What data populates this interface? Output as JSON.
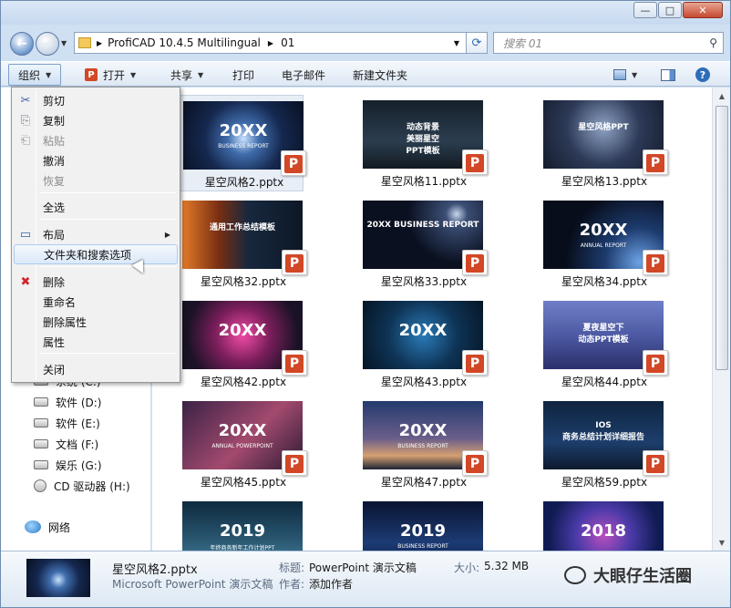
{
  "window": {
    "minimize": "—",
    "maximize": "□",
    "close": "✕"
  },
  "address": {
    "path": [
      "ProfiCAD 10.4.5 Multilingual",
      "01"
    ],
    "search_placeholder": "搜索 01"
  },
  "toolbar": {
    "organize": "组织",
    "open": "打开",
    "share": "共享",
    "print": "打印",
    "email": "电子邮件",
    "new_folder": "新建文件夹"
  },
  "context_menu": {
    "items": [
      "剪切",
      "复制",
      "粘贴",
      "撤消",
      "恢复",
      "全选",
      "布局",
      "文件夹和搜索选项",
      "删除",
      "重命名",
      "删除属性",
      "属性",
      "关闭"
    ],
    "disabled": [
      "粘贴",
      "恢复"
    ],
    "highlighted": "文件夹和搜索选项"
  },
  "nav": {
    "items": [
      "系统 (C:)",
      "软件 (D:)",
      "软件 (E:)",
      "文档 (F:)",
      "娱乐 (G:)",
      "CD 驱动器 (H:)",
      "网络"
    ]
  },
  "files": [
    {
      "name": "星空风格2.pptx",
      "thumb_text": "20XX",
      "thumb_sub": "BUSINESS REPORT",
      "bg": "radial-gradient(circle at 50% 55%,#c8e2ff 0%,#3f6cab 22%,#15284f 55%,#081021 100%)"
    },
    {
      "name": "星空风格11.pptx",
      "thumb_text": "动态背景\n美丽星空\nPPT模板",
      "thumb_sub": "",
      "bg": "linear-gradient(#15202b,#2b3d4f 60%,#121a22)"
    },
    {
      "name": "星空风格13.pptx",
      "thumb_text": "星空风格PPT",
      "thumb_sub": "",
      "bg": "radial-gradient(circle at 50% 40%,#8fa3c4,#2d3a58 50%,#141b2b)"
    },
    {
      "name": "星空风格32.pptx",
      "thumb_text": "通用工作总结模板",
      "thumb_sub": "",
      "bg": "linear-gradient(90deg,#e37b29,#7a2e12 30%,#17283e 55%,#0d1726)"
    },
    {
      "name": "星空风格33.pptx",
      "thumb_text": "20XX BUSINESS REPORT",
      "thumb_sub": "",
      "bg": "radial-gradient(circle at 78% 20%,#c7d6ef,#3b4e74 10%,#0a1020 45%)"
    },
    {
      "name": "星空风格34.pptx",
      "thumb_text": "20XX",
      "thumb_sub": "ANNUAL REPORT",
      "bg": "radial-gradient(circle at 80% 90%,#6da3e6,#1d3b6e 30%,#070d1a 65%)"
    },
    {
      "name": "星空风格42.pptx",
      "thumb_text": "20XX",
      "thumb_sub": "",
      "bg": "radial-gradient(circle at 50% 50%,#f04ca6,#7a1e5a 40%,#1a1226 80%)"
    },
    {
      "name": "星空风格43.pptx",
      "thumb_text": "20XX",
      "thumb_sub": "",
      "bg": "radial-gradient(circle at 50% 50%,#2a7bb8,#0e3456 50%,#061524)"
    },
    {
      "name": "星空风格44.pptx",
      "thumb_text": "夏夜星空下\n动态PPT模板",
      "thumb_sub": "",
      "bg": "linear-gradient(#6f7fc7,#4d5aa3 50%,#2a2f6a)"
    },
    {
      "name": "星空风格45.pptx",
      "thumb_text": "20XX",
      "thumb_sub": "ANNUAL POWERPOINT",
      "bg": "linear-gradient(135deg,#3a2246,#a34a6e 55%,#2a1a33)"
    },
    {
      "name": "星空风格47.pptx",
      "thumb_text": "20XX",
      "thumb_sub": "BUSINESS REPORT",
      "bg": "linear-gradient(#243a6e,#6b5f8a 55%,#d5a071 80%,#1b2334)"
    },
    {
      "name": "星空风格59.pptx",
      "thumb_text": "IOS\n商务总结计划详细报告",
      "thumb_sub": "",
      "bg": "linear-gradient(#0f2440,#1d3e6b 60%,#0d1a2e)"
    },
    {
      "name": "",
      "thumb_text": "2019",
      "thumb_sub": "年终商务新年工作计划PPT",
      "bg": "linear-gradient(#0e2a3e,#2b5a75 60%,#4a8aa1)"
    },
    {
      "name": "",
      "thumb_text": "2019",
      "thumb_sub": "BUSINESS REPORT",
      "bg": "linear-gradient(#0a1430,#1c3b75 60%,#0b1a3a)"
    },
    {
      "name": "",
      "thumb_text": "2018",
      "thumb_sub": "",
      "bg": "radial-gradient(circle at 50% 50%,#b84fbf,#4a3aa8 40%,#0f1b52 80%)"
    }
  ],
  "details": {
    "filename": "星空风格2.pptx",
    "filetype": "Microsoft PowerPoint 演示文稿",
    "title_label": "标题:",
    "title_value": "PowerPoint 演示文稿",
    "author_label": "作者:",
    "author_value": "添加作者",
    "size_label": "大小:",
    "size_value": "5.32 MB"
  },
  "watermark": "大眼仔生活圈"
}
